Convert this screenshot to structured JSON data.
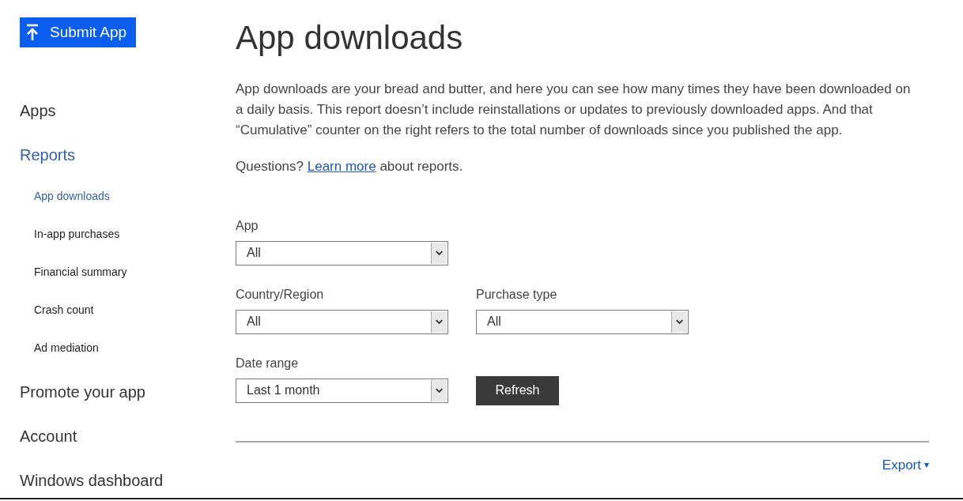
{
  "submit_button": {
    "label": "Submit App"
  },
  "sidebar": {
    "items": [
      {
        "label": "Apps",
        "selected": false
      },
      {
        "label": "Reports",
        "selected": true,
        "children": [
          {
            "label": "App downloads",
            "selected": true
          },
          {
            "label": "In-app purchases",
            "selected": false
          },
          {
            "label": "Financial summary",
            "selected": false
          },
          {
            "label": "Crash count",
            "selected": false
          },
          {
            "label": "Ad mediation",
            "selected": false
          }
        ]
      },
      {
        "label": "Promote your app",
        "selected": false
      },
      {
        "label": "Account",
        "selected": false
      },
      {
        "label": "Windows dashboard",
        "selected": false
      }
    ]
  },
  "page": {
    "title": "App downloads",
    "description": "App downloads are your bread and butter, and here you can see how many times they have been downloaded on a daily basis. This report doesn’t include reinstallations or updates to previously downloaded apps. And that “Cumulative” counter on the right refers to the total number of downloads since you published the app.",
    "questions": {
      "before": "Questions?",
      "link": "Learn more",
      "after": "about reports."
    }
  },
  "filters": [
    [
      {
        "kind": "select",
        "label": "App",
        "value": "All"
      }
    ],
    [
      {
        "kind": "select",
        "label": "Country/Region",
        "value": "All"
      },
      {
        "kind": "select",
        "label": "Purchase type",
        "value": "All"
      }
    ],
    [
      {
        "kind": "select",
        "label": "Date range",
        "value": "Last 1 month"
      },
      {
        "kind": "button",
        "label": "Refresh"
      }
    ]
  ],
  "export": {
    "label": "Export",
    "caret": "▾"
  }
}
